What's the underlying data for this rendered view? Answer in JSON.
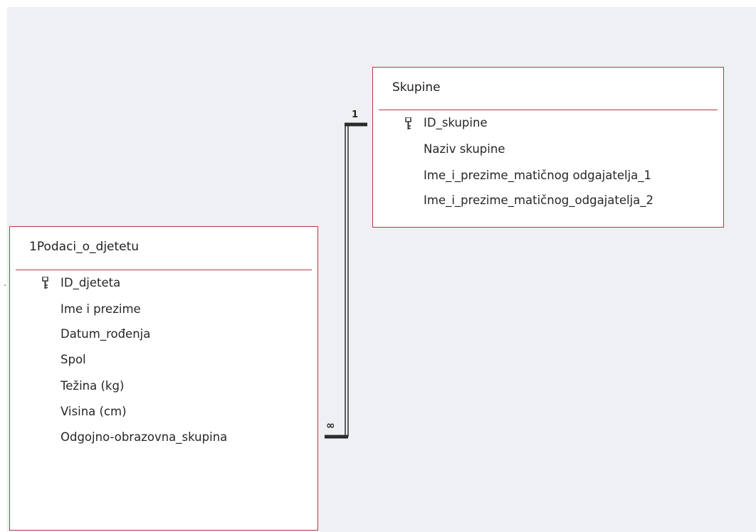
{
  "tables": {
    "skupine": {
      "name": "Skupine",
      "fields": [
        {
          "label": "ID_skupine",
          "primary_key": true
        },
        {
          "label": "Naziv skupine",
          "primary_key": false
        },
        {
          "label": "Ime_i_prezime_matičnog odgajatelja_1",
          "primary_key": false
        },
        {
          "label": "Ime_i_prezime_matičnog_odgajatelja_2",
          "primary_key": false
        }
      ]
    },
    "podaci": {
      "name": "1Podaci_o_djetetu",
      "fields": [
        {
          "label": "ID_djeteta",
          "primary_key": true
        },
        {
          "label": "Ime i prezime",
          "primary_key": false
        },
        {
          "label": "Datum_rođenja",
          "primary_key": false
        },
        {
          "label": "Spol",
          "primary_key": false
        },
        {
          "label": "Težina (kg)",
          "primary_key": false
        },
        {
          "label": "Visina (cm)",
          "primary_key": false
        },
        {
          "label": "Odgojno-obrazovna_skupina",
          "primary_key": false
        }
      ]
    }
  },
  "relationship": {
    "one_side_label": "1",
    "many_side_label": "∞"
  },
  "colors": {
    "table_border": "#b03a48",
    "workspace_background": "#eef0f3",
    "relationship_line": "#2b2b2b"
  },
  "icons": {
    "primary_key": "key-icon"
  }
}
